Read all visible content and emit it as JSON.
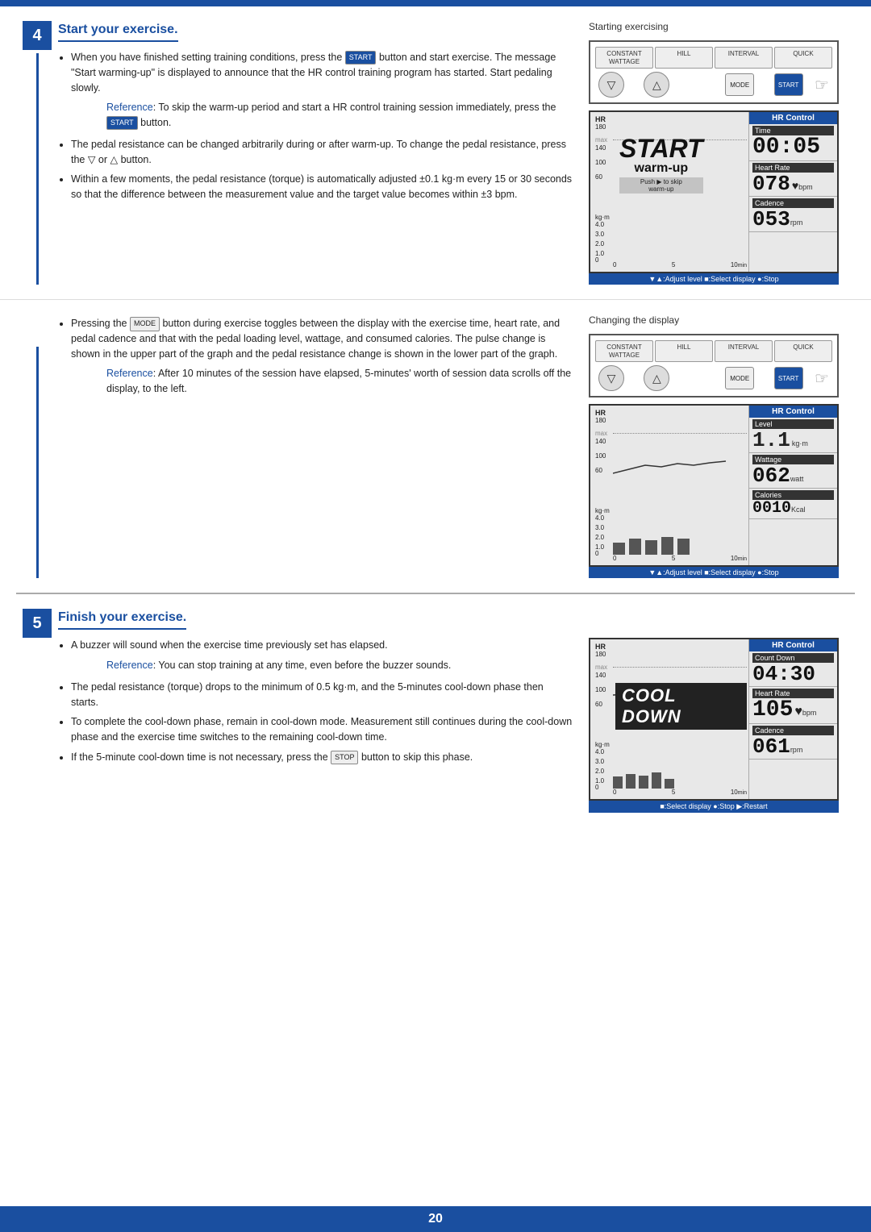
{
  "topBar": {
    "color": "#1a4fa0"
  },
  "pageNumber": "20",
  "sections": [
    {
      "id": "section4",
      "stepNumber": "4",
      "title": "Start your exercise.",
      "paragraphs": [
        {
          "type": "bullet",
          "text": "When you have finished setting training conditions, press the [START] button and start exercise. The message \"Start warming-up\" is displayed to announce that the HR control training program has started. Start pedaling slowly."
        },
        {
          "type": "indent",
          "text": "Reference: To skip the warm-up period and start a HR control training session immediately, press the [START] button."
        },
        {
          "type": "bullet",
          "text": "The pedal resistance can be changed arbitrarily during or after warm-up. To change the pedal resistance, press the ▽ or △ button."
        },
        {
          "type": "bullet",
          "text": "Within a few moments, the pedal resistance (torque) is automatically adjusted ±0.1 kg·m every 15 or 30 seconds so that the difference between the measurement value and the target value becomes within ±3 bpm."
        }
      ],
      "displays": [
        {
          "label": "Starting exercising",
          "type": "start_warmup",
          "hr_control": "HR Control",
          "time_label": "Time",
          "time_value": "00:05",
          "heart_rate_label": "Heart Rate",
          "heart_rate_value": "078",
          "heart_rate_unit": "bpm",
          "cadence_label": "Cadence",
          "cadence_value": "053",
          "cadence_unit": "rpm",
          "bottom_bar": "▼▲:Adjust level  ■:Select display  ●:Stop"
        }
      ]
    },
    {
      "id": "section4b",
      "stepNumber": null,
      "title": null,
      "paragraphs": [
        {
          "type": "bullet",
          "text": "Pressing the [MODE] button during exercise toggles between the display with the exercise time, heart rate, and pedal cadence and that with the pedal loading level, wattage, and consumed calories. The pulse change is shown in the upper part of the graph and the pedal resistance change is shown in the lower part of the graph."
        },
        {
          "type": "indent",
          "text": "Reference: After 10 minutes of the session have elapsed, 5-minutes' worth of session data scrolls off the display, to the left."
        }
      ],
      "displays": [
        {
          "label": "Changing the display",
          "type": "level_wattage",
          "hr_control": "HR Control",
          "level_label": "Level",
          "level_value": "1.1",
          "level_unit": "kg·m",
          "wattage_label": "Wattage",
          "wattage_value": "062",
          "wattage_unit": "watt",
          "calories_label": "Calories",
          "calories_value": "0010",
          "calories_unit": "Kcal",
          "bottom_bar": "▼▲:Adjust level  ■:Select display  ●:Stop"
        }
      ]
    },
    {
      "id": "section5",
      "stepNumber": "5",
      "title": "Finish your exercise.",
      "paragraphs": [
        {
          "type": "bullet",
          "text": "A buzzer will sound when the exercise time previously set has elapsed."
        },
        {
          "type": "indent",
          "text": "Reference: You can stop training at any time, even before the buzzer sounds."
        },
        {
          "type": "bullet",
          "text": "The pedal resistance (torque) drops to the minimum of 0.5 kg·m, and the 5-minutes cool-down phase then starts."
        },
        {
          "type": "bullet",
          "text": "To complete the cool-down phase, remain in cool-down mode. Measurement still continues during the cool-down phase and the exercise time switches to the remaining cool-down time."
        },
        {
          "type": "bullet",
          "text": "If the 5-minute cool-down time is not necessary, press the [STOP] button to skip this phase."
        }
      ],
      "displays": [
        {
          "label": "",
          "type": "cool_down",
          "hr_control": "HR Control",
          "countdown_label": "Count Down",
          "countdown_value": "04:30",
          "heart_rate_label": "Heart Rate",
          "heart_rate_value": "105",
          "heart_rate_unit": "bpm",
          "cadence_label": "Cadence",
          "cadence_value": "061",
          "cadence_unit": "rpm",
          "bottom_bar": "■:Select display  ●:Stop  ▶:Restart"
        }
      ]
    }
  ]
}
